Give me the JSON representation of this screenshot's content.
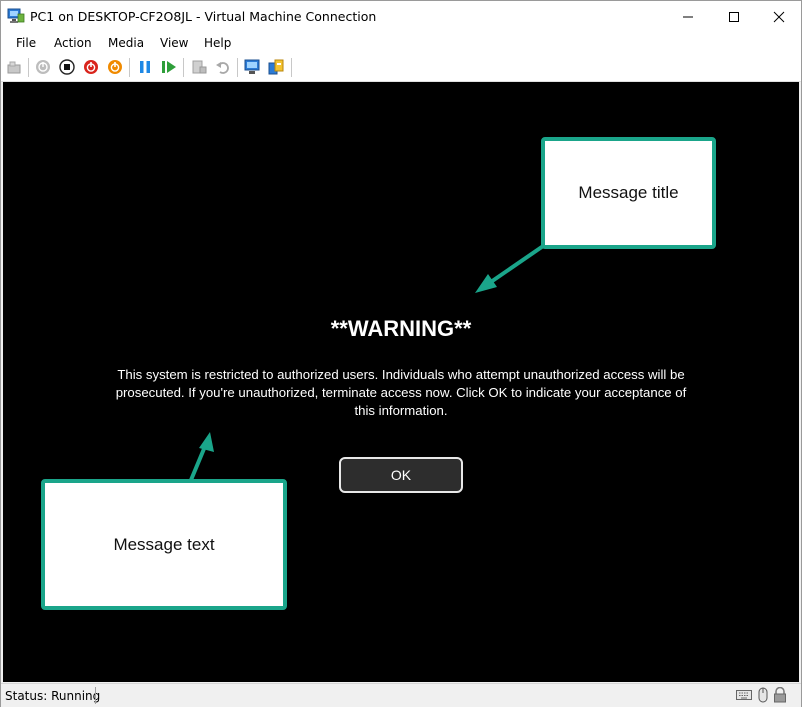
{
  "window": {
    "title": "PC1 on DESKTOP-CF2O8JL - Virtual Machine Connection"
  },
  "menu": [
    "File",
    "Action",
    "Media",
    "View",
    "Help"
  ],
  "toolbar": {
    "icons": [
      "ctrl-alt-del-icon",
      "start-icon",
      "turn-off-icon",
      "shut-down-icon",
      "power-icon",
      "pause-icon",
      "resume-icon",
      "checkpoint-icon",
      "revert-icon",
      "enhanced-session-icon",
      "share-icon"
    ]
  },
  "screen": {
    "title": "**WARNING**",
    "text": "This system is restricted to authorized users. Individuals who attempt unauthorized access will be prosecuted. If you're unauthorized, terminate access now. Click OK to indicate your acceptance of this information.",
    "ok_label": "OK"
  },
  "annotations": {
    "callout_title": "Message title",
    "callout_text": "Message text",
    "accent": "#1aa58a"
  },
  "status": {
    "text": "Status: Running"
  }
}
